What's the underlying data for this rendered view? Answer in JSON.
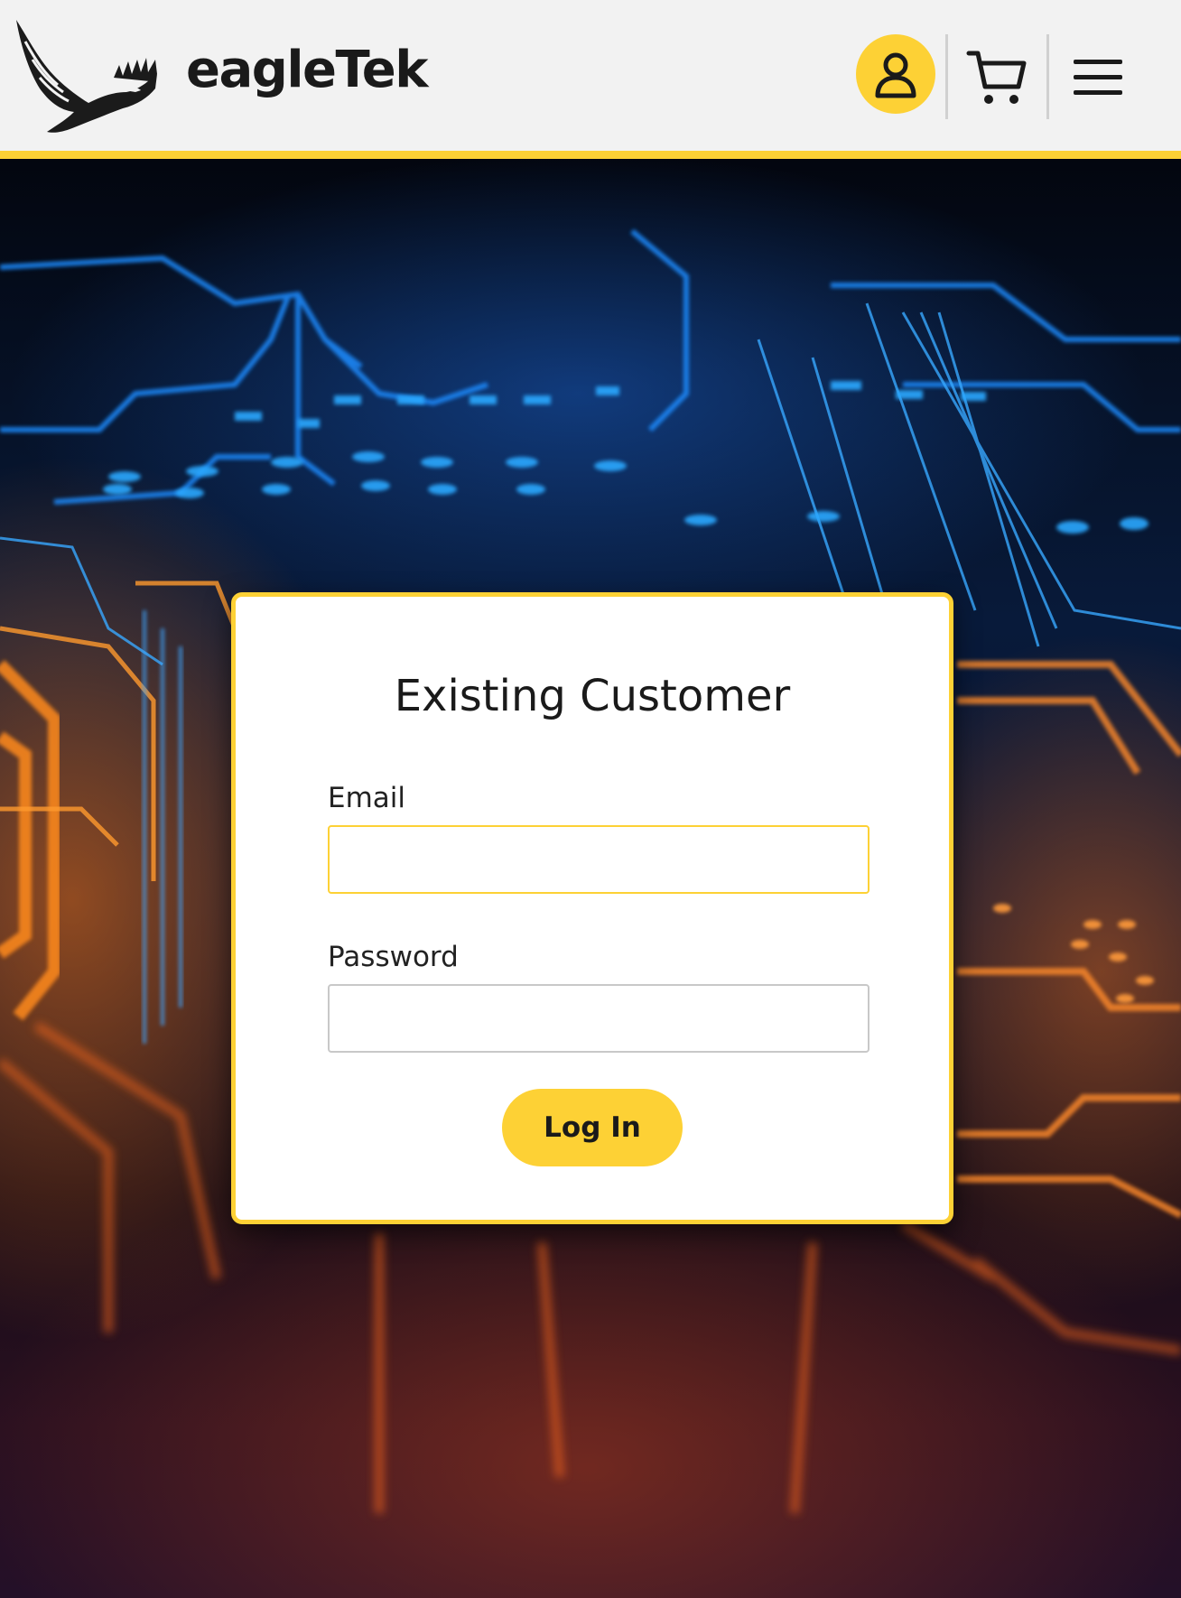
{
  "header": {
    "brand": "eagleTek",
    "logo_icon": "eagle-logo-icon",
    "account_icon": "user-icon",
    "cart_icon": "cart-icon",
    "menu_icon": "hamburger-menu-icon"
  },
  "login": {
    "title": "Existing Customer",
    "email_label": "Email",
    "email_value": "",
    "password_label": "Password",
    "password_value": "",
    "submit_label": "Log In"
  },
  "colors": {
    "accent": "#fdd135",
    "header_bg": "#f2f2f2",
    "text": "#1a1a1a",
    "card_bg": "#ffffff"
  }
}
